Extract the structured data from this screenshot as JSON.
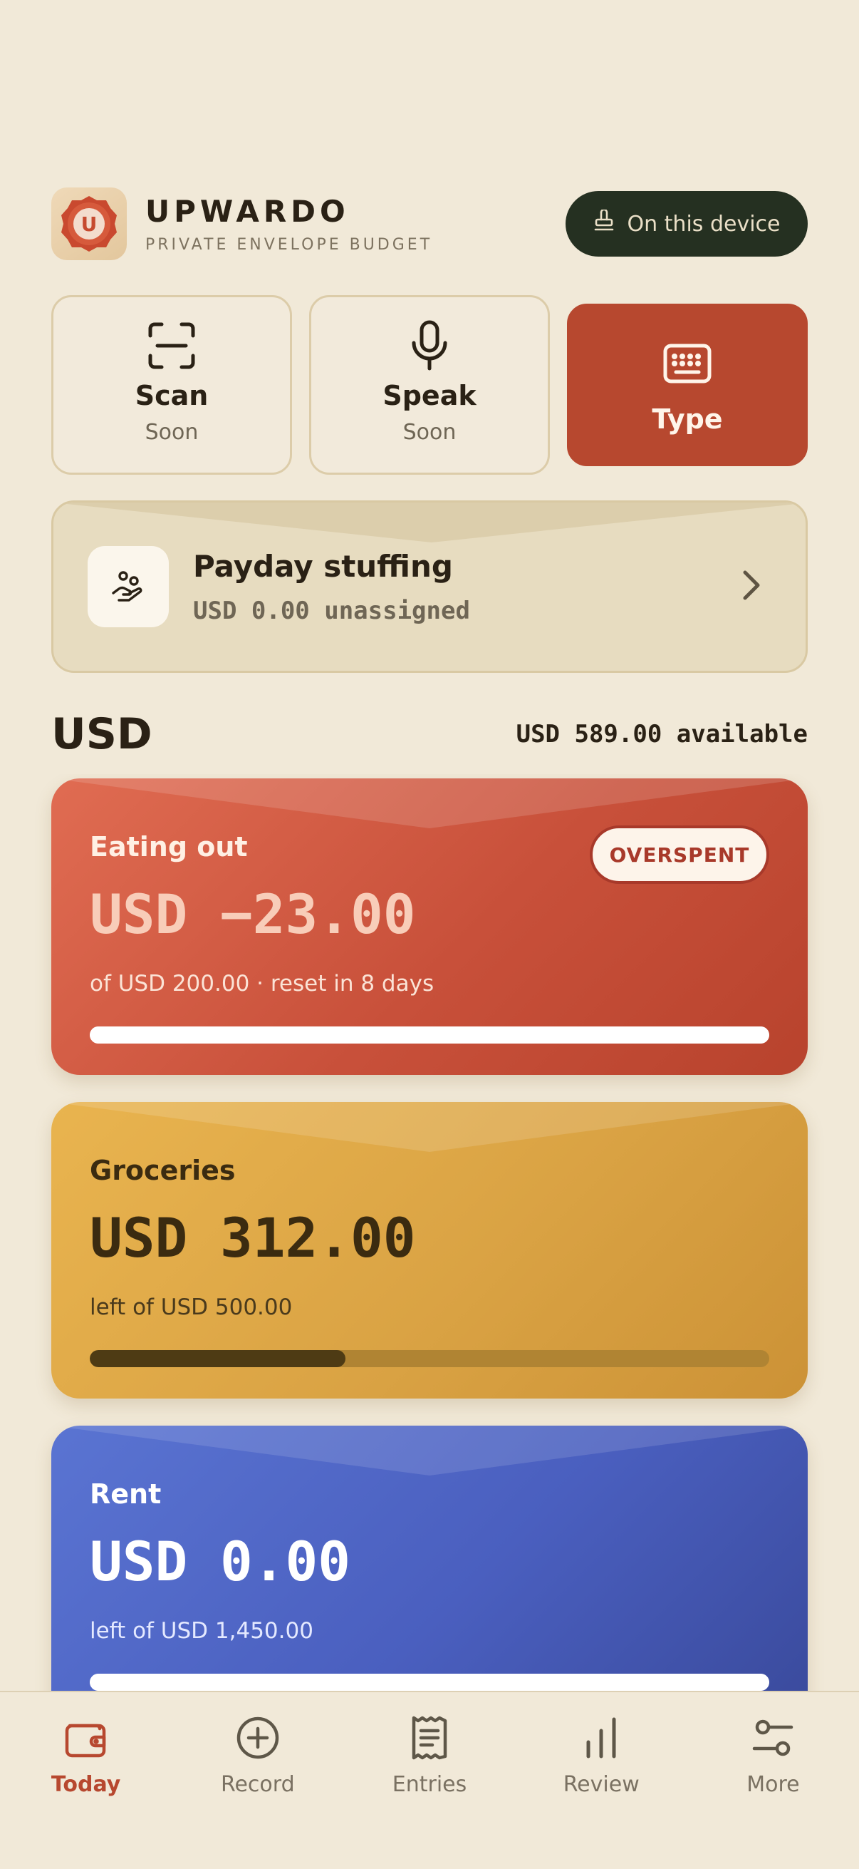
{
  "app": {
    "name": "UPWARDO",
    "tagline": "PRIVATE ENVELOPE BUDGET",
    "logo_letter": "U",
    "device_label": "On this device",
    "device_icon": "hand-stamp-icon"
  },
  "capture": {
    "scan": {
      "label": "Scan",
      "sub": "Soon",
      "icon": "scan-frame-icon"
    },
    "speak": {
      "label": "Speak",
      "sub": "Soon",
      "icon": "microphone-icon"
    },
    "type": {
      "label": "Type",
      "icon": "keyboard-icon"
    }
  },
  "payday": {
    "title": "Payday stuffing",
    "subtitle": "USD 0.00 unassigned",
    "icon": "hand-coins-icon"
  },
  "section": {
    "title": "USD",
    "available": "USD 589.00 available"
  },
  "envelopes": [
    {
      "name": "Eating out",
      "amount": "USD −23.00",
      "note": "of USD 200.00 · reset in 8 days",
      "badge": "OVERSPENT",
      "progress": 1.0
    },
    {
      "name": "Groceries",
      "amount": "USD 312.00",
      "note": "left of USD 500.00",
      "progress": 0.376
    },
    {
      "name": "Rent",
      "amount": "USD 0.00",
      "note": "left of USD 1,450.00",
      "progress": 1.0
    }
  ],
  "tabs": [
    {
      "label": "Today",
      "icon": "wallet-icon",
      "active": true
    },
    {
      "label": "Record",
      "icon": "plus-circle-icon"
    },
    {
      "label": "Entries",
      "icon": "receipt-icon"
    },
    {
      "label": "Review",
      "icon": "bar-chart-icon"
    },
    {
      "label": "More",
      "icon": "sliders-icon"
    }
  ],
  "colors": {
    "background": "#f1e9d8",
    "accent": "#b7482f",
    "dark_pill": "#253021",
    "eating_out": "#d35a40",
    "groceries": "#dfa948",
    "rent": "#4a5fbf"
  }
}
